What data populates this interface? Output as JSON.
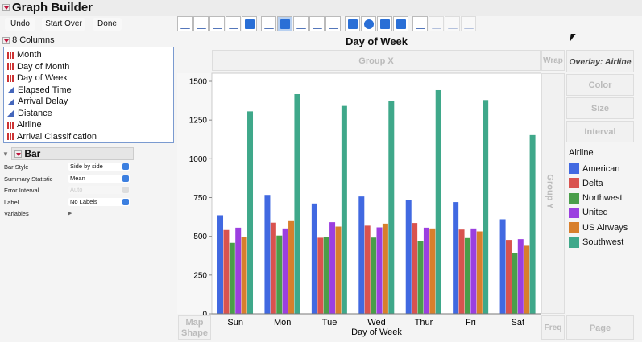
{
  "title": "Graph Builder",
  "toolbar": {
    "undo": "Undo",
    "start_over": "Start Over",
    "done": "Done"
  },
  "columns": {
    "header": "8 Columns",
    "items": [
      {
        "label": "Month",
        "type": "nominal"
      },
      {
        "label": "Day of Month",
        "type": "nominal"
      },
      {
        "label": "Day of Week",
        "type": "nominal"
      },
      {
        "label": "Elapsed Time",
        "type": "continuous"
      },
      {
        "label": "Arrival Delay",
        "type": "continuous"
      },
      {
        "label": "Distance",
        "type": "continuous"
      },
      {
        "label": "Airline",
        "type": "nominal"
      },
      {
        "label": "Arrival Classification",
        "type": "nominal"
      }
    ]
  },
  "bar_panel": {
    "title": "Bar",
    "props": [
      {
        "label": "Bar Style",
        "value": "Side by side"
      },
      {
        "label": "Summary Statistic",
        "value": "Mean"
      },
      {
        "label": "Error Interval",
        "value": "Auto"
      },
      {
        "label": "Label",
        "value": "No Labels"
      },
      {
        "label": "Variables",
        "value": ""
      }
    ]
  },
  "zones": {
    "group_x": "Group X",
    "wrap": "Wrap",
    "overlay": "Overlay: Airline",
    "color": "Color",
    "size": "Size",
    "interval": "Interval",
    "group_y": "Group Y",
    "map_shape_1": "Map",
    "map_shape_2": "Shape",
    "freq": "Freq",
    "page": "Page"
  },
  "chart_data": {
    "type": "bar",
    "title": "Day of Week",
    "xlabel": "Day of Week",
    "ylabel": "",
    "ylim": [
      0,
      1550
    ],
    "yticks": [
      0,
      250,
      500,
      750,
      1000,
      1250,
      1500
    ],
    "categories": [
      "Sun",
      "Mon",
      "Tue",
      "Wed",
      "Thur",
      "Fri",
      "Sat"
    ],
    "legend_title": "Airline",
    "legend_position": "right",
    "series": [
      {
        "name": "American",
        "color": "#4169e1",
        "values": [
          636,
          767,
          712,
          757,
          736,
          721,
          610
        ]
      },
      {
        "name": "Delta",
        "color": "#d9534f",
        "values": [
          541,
          588,
          491,
          569,
          586,
          544,
          477
        ]
      },
      {
        "name": "Northwest",
        "color": "#4a9e4a",
        "values": [
          458,
          505,
          498,
          492,
          468,
          489,
          391
        ]
      },
      {
        "name": "United",
        "color": "#9b3fe0",
        "values": [
          556,
          551,
          591,
          558,
          556,
          551,
          482
        ]
      },
      {
        "name": "US Airways",
        "color": "#d87f2c",
        "values": [
          494,
          598,
          563,
          582,
          551,
          532,
          439
        ]
      },
      {
        "name": "Southwest",
        "color": "#3fa88a",
        "values": [
          1306,
          1417,
          1341,
          1374,
          1443,
          1379,
          1153
        ]
      }
    ]
  }
}
